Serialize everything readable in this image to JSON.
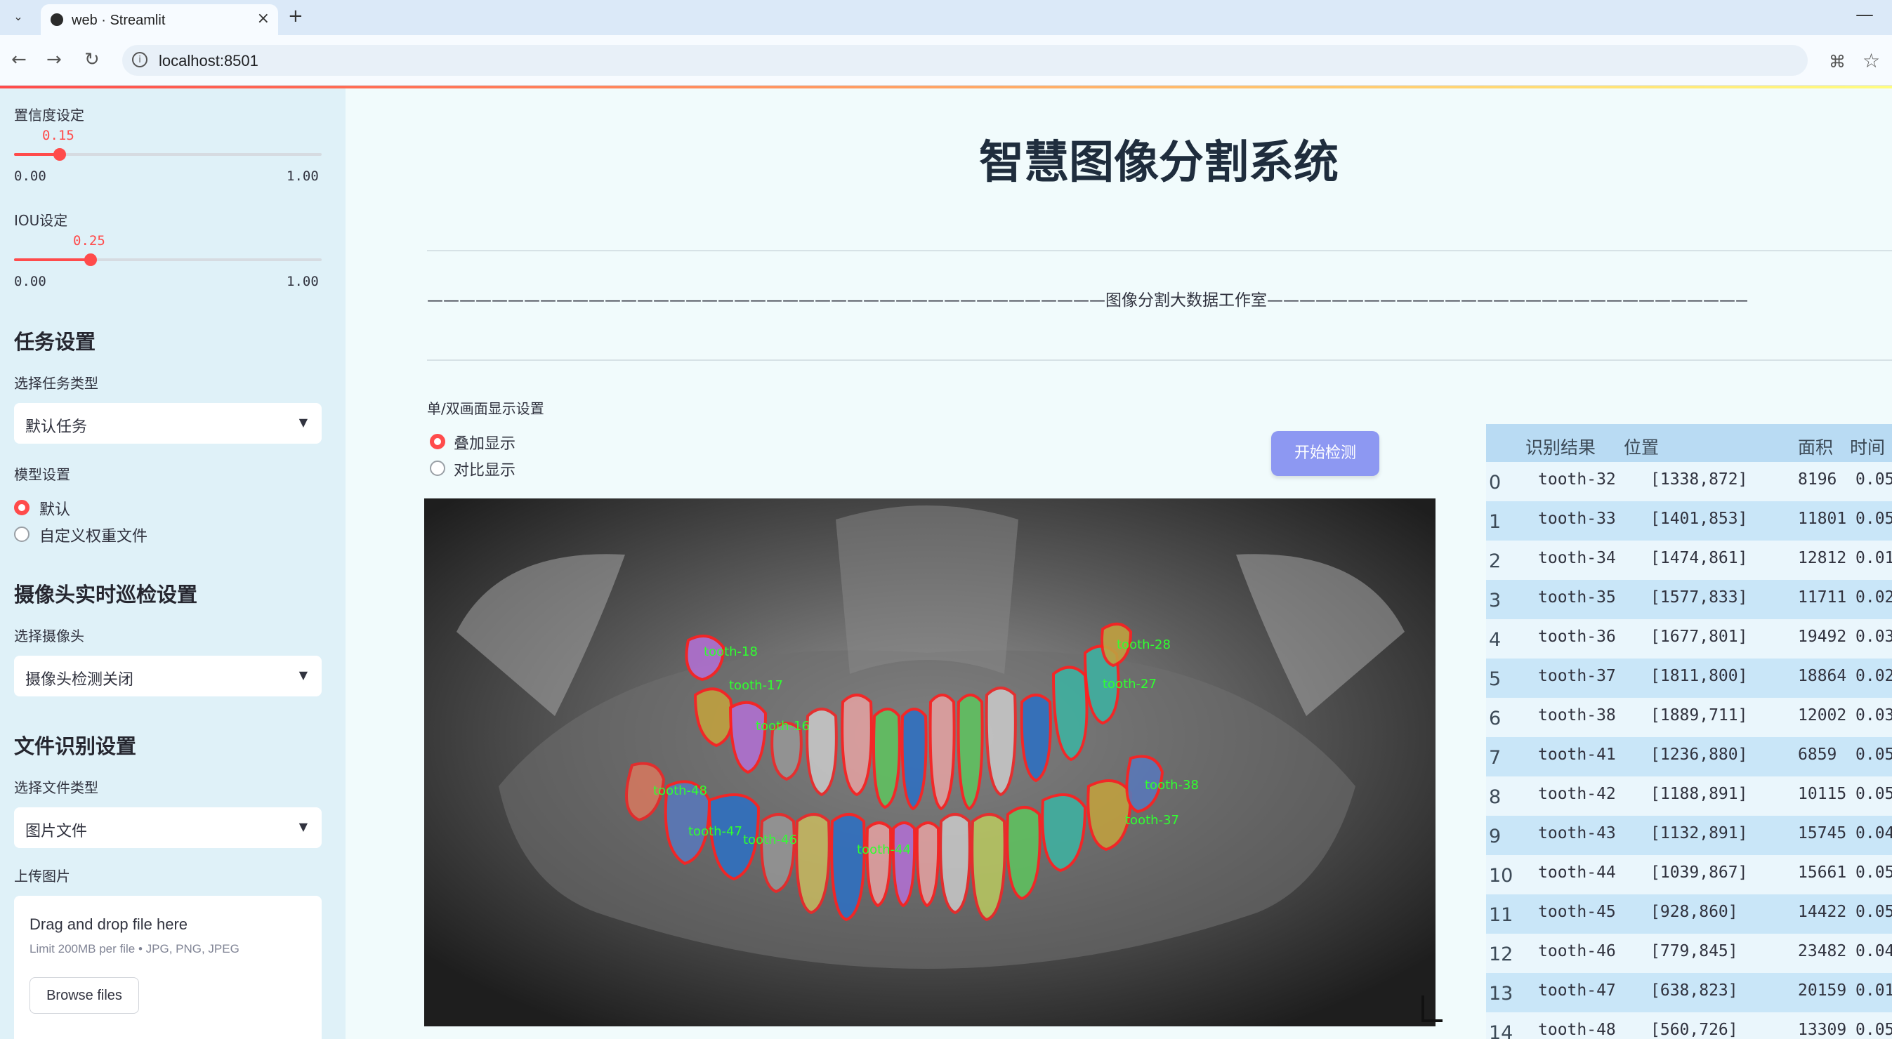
{
  "browser": {
    "tab_title": "web · Streamlit",
    "url": "localhost:8501",
    "new_tab": "+",
    "close": "×",
    "menu": "⌄",
    "minimize": "—"
  },
  "sidebar": {
    "confidence": {
      "label": "置信度设定",
      "value": "0.15",
      "min": "0.00",
      "max": "1.00",
      "fraction": 0.15
    },
    "iou": {
      "label": "IOU设定",
      "value": "0.25",
      "min": "0.00",
      "max": "1.00",
      "fraction": 0.25
    },
    "task_heading": "任务设置",
    "task_type_label": "选择任务类型",
    "task_type_value": "默认任务",
    "model_label": "模型设置",
    "model_options": [
      "默认",
      "自定义权重文件"
    ],
    "camera_heading": "摄像头实时巡检设置",
    "camera_label": "选择摄像头",
    "camera_value": "摄像头检测关闭",
    "file_heading": "文件识别设置",
    "file_type_label": "选择文件类型",
    "file_type_value": "图片文件",
    "upload_label": "上传图片",
    "upload_title": "Drag and drop file here",
    "upload_sub": "Limit 200MB per file • JPG, PNG, JPEG",
    "browse_label": "Browse files"
  },
  "main": {
    "title": "智慧图像分割系统",
    "studio": "——————————————————————————————————————————图像分割大数据工作室——————————————————————————————————————————",
    "display_label": "单/双画面显示设置",
    "display_options": [
      "叠加显示",
      "对比显示"
    ],
    "start_button": "开始检测"
  },
  "table": {
    "headers": [
      "识别结果",
      "位置",
      "面积",
      "时间"
    ],
    "rows": [
      [
        "0",
        "tooth-32",
        "[1338,872]",
        "8196",
        "0.05"
      ],
      [
        "1",
        "tooth-33",
        "[1401,853]",
        "11801",
        "0.05"
      ],
      [
        "2",
        "tooth-34",
        "[1474,861]",
        "12812",
        "0.01"
      ],
      [
        "3",
        "tooth-35",
        "[1577,833]",
        "11711",
        "0.02"
      ],
      [
        "4",
        "tooth-36",
        "[1677,801]",
        "19492",
        "0.03"
      ],
      [
        "5",
        "tooth-37",
        "[1811,800]",
        "18864",
        "0.02"
      ],
      [
        "6",
        "tooth-38",
        "[1889,711]",
        "12002",
        "0.03"
      ],
      [
        "7",
        "tooth-41",
        "[1236,880]",
        "6859",
        "0.05"
      ],
      [
        "8",
        "tooth-42",
        "[1188,891]",
        "10115",
        "0.05"
      ],
      [
        "9",
        "tooth-43",
        "[1132,891]",
        "15745",
        "0.04"
      ],
      [
        "10",
        "tooth-44",
        "[1039,867]",
        "15661",
        "0.05"
      ],
      [
        "11",
        "tooth-45",
        "[928,860]",
        "14422",
        "0.05"
      ],
      [
        "12",
        "tooth-46",
        "[779,845]",
        "23482",
        "0.04"
      ],
      [
        "13",
        "tooth-47",
        "[638,823]",
        "20159",
        "0.01"
      ],
      [
        "14",
        "tooth-48",
        "[560,726]",
        "13309",
        "0.05"
      ]
    ]
  },
  "xray_labels": [
    "tooth-18",
    "tooth-17",
    "tooth-16",
    "tooth-28",
    "tooth-27",
    "tooth-48",
    "tooth-47",
    "tooth-46",
    "tooth-38",
    "tooth-37",
    "tooth-44"
  ],
  "colors": {
    "accent": "#ff4b4b",
    "button": "#8d98f2",
    "sidebar": "#dff1f8",
    "table_header": "#b9dbf3"
  }
}
